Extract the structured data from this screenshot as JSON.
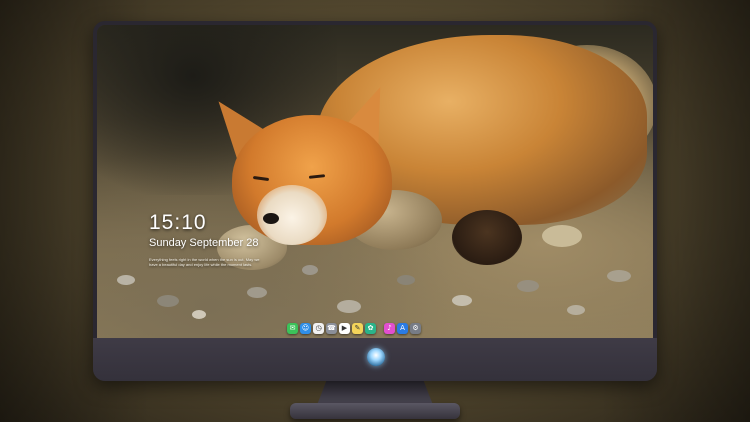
{
  "lock_screen": {
    "time": "15:10",
    "date": "Sunday September 28",
    "note": "Everything feels right in the world when the sun is out. May we have a beautiful day and enjoy life while the moment lasts."
  },
  "dock": {
    "apps": [
      {
        "name": "messages-icon",
        "glyph": "✉",
        "color": "#3cc25a"
      },
      {
        "name": "finder-icon",
        "glyph": "☺",
        "color": "#2f8fe8"
      },
      {
        "name": "clock-icon",
        "glyph": "◷",
        "color": "#f1f1f1"
      },
      {
        "name": "contacts-icon",
        "glyph": "☎",
        "color": "#8b8f99"
      },
      {
        "name": "video-icon",
        "glyph": "▶",
        "color": "#ffffff"
      },
      {
        "name": "notes-icon",
        "glyph": "✎",
        "color": "#f4d45a"
      },
      {
        "name": "photos-icon",
        "glyph": "✿",
        "color": "#2bb48a"
      },
      {
        "name": "music-icon",
        "glyph": "♪",
        "color": "#e24fcf"
      },
      {
        "name": "appstore-icon",
        "glyph": "A",
        "color": "#2a7be4"
      },
      {
        "name": "settings-icon",
        "glyph": "⚙",
        "color": "#777c86"
      }
    ]
  }
}
